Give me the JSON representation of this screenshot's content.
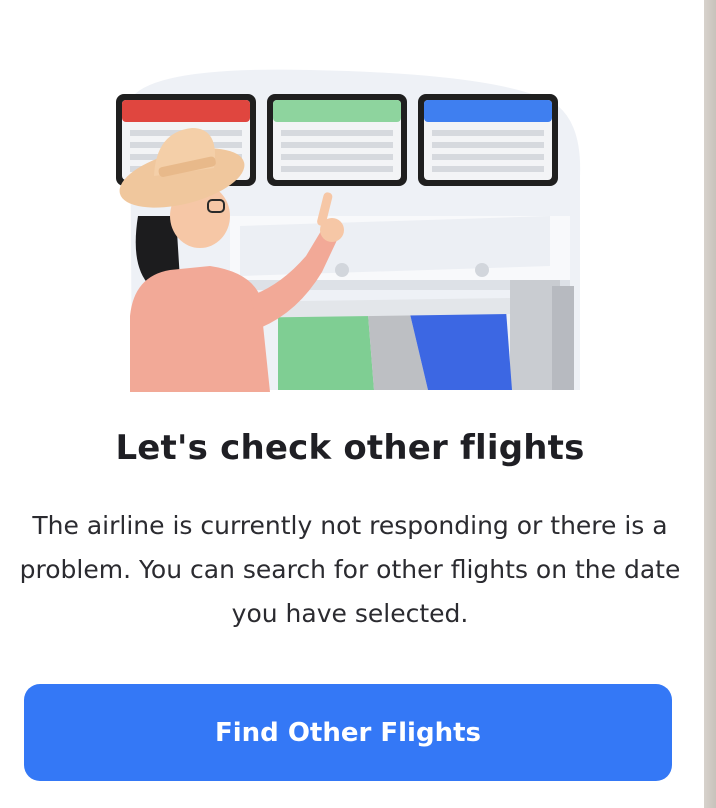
{
  "dialog": {
    "title": "Let's check other flights",
    "description": "The airline is currently not responding or there is a problem. You can search for other flights on the date you have selected.",
    "button_label": "Find Other Flights"
  },
  "illustration": {
    "board_colors": [
      "#e0463f",
      "#8ed49e",
      "#3f7ff0"
    ]
  },
  "colors": {
    "accent": "#3478f6",
    "title": "#1f1f24",
    "text": "#2b2b30"
  }
}
